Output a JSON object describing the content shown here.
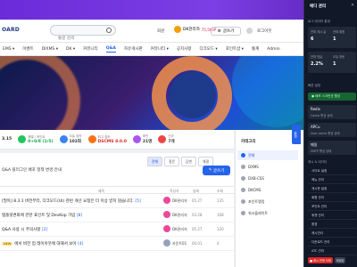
{
  "header": {
    "logo": "OARD",
    "search_placeholder": "통합 검색",
    "member_label": "회원",
    "user_name": "DK관리자",
    "points": "75,560P",
    "write_label": "글쓰기",
    "login_label": "로그아웃"
  },
  "nav": {
    "items": [
      "EMS ▾",
      "이벤트",
      "DIXMS ▾",
      "DK ▾",
      "커뮤니티",
      "Q&A",
      "자유게시판",
      "커뮤니티 ▾",
      "공지사항",
      "다크모드 ▾",
      "포인트샵 ▾",
      "통계",
      "Admin"
    ]
  },
  "stats": [
    {
      "label": "",
      "value": "3.15"
    },
    {
      "label": "레벨 / 포인트",
      "value": "0+0/8 (1/5)"
    },
    {
      "label": "오늘 접속",
      "value": "102회"
    },
    {
      "label": "최고 접속",
      "value": "DSCMS 8.0.0"
    },
    {
      "label": "화인",
      "value": "21명"
    },
    {
      "label": "신규",
      "value": "7개"
    }
  ],
  "board": {
    "title": "Q&A 플러그인 배포 정책 변경 안내",
    "filters": [
      "전체",
      "질문",
      "답변",
      "해결"
    ],
    "write_button": "글쓰기",
    "columns": {
      "subject": "제목",
      "author": "작성자",
      "date": "날짜",
      "views": "조회"
    },
    "rows": [
      {
        "badge": "",
        "title": "[필독] 8.3.1 버전부터, 다크모드(UI) 관련 개선 요청은 더 이상 받지 않습니다.",
        "count": "[5]",
        "author": "DK관리자",
        "date": "05.27",
        "views": "135"
      },
      {
        "badge": "",
        "title": "템플릿변화에 관한 표인트 및 DevKop 가입",
        "count": "[8]",
        "author": "DK관리자",
        "date": "03.28",
        "views": "168"
      },
      {
        "badge": "",
        "title": "Q&A 사용 시 주의사항",
        "count": "[2]",
        "author": "DK관리자",
        "date": "05.27",
        "views": "120"
      },
      {
        "badge": "NEW",
        "title": "에서 버전 업 레이아웃에 대해서 보아",
        "count": "[4]",
        "author": "카운트01",
        "date": "00.01",
        "views": "4"
      }
    ]
  },
  "categories": {
    "header": "카테고리",
    "items": [
      "전체",
      "DXMS",
      "DXB-CSS",
      "DKCMS",
      "포인트랭킹",
      "워크플레이트"
    ]
  },
  "side_tab": "위젯",
  "admin": {
    "title": "에디 관리",
    "close": "✕",
    "section1": "로그 데이터 통계",
    "card1_label1": "전체 게시 글",
    "card1_val1": "6",
    "card1_label2": "전체 회원",
    "card1_val2": "1",
    "card2_label": "전체 댓글",
    "card2_val": "2.2%",
    "card2_label2": "오늘 방문",
    "card2_val2": "1",
    "section2": "빠른 설정",
    "green_button": "● 배포 스크린샷 활성",
    "card3_label": "Redis",
    "card3_sub": "Cache 활성 상태",
    "card4_label": "APCu",
    "card4_sub": "User cache 활성 상태",
    "card5_label": "메일",
    "card5_sub": "SMTP 활성 상태",
    "section3": "캐시 & 데이터",
    "menu": [
      "사이트 설정",
      "메뉴 관리",
      "게시판 설정",
      "회원 관리",
      "포인트 관리",
      "위젯 관리",
      "환경",
      "캐시관리",
      "다운로드 관리",
      "ATC 관리"
    ],
    "footer": [
      "■ 캐시 전체 삭제",
      "재생성"
    ]
  }
}
